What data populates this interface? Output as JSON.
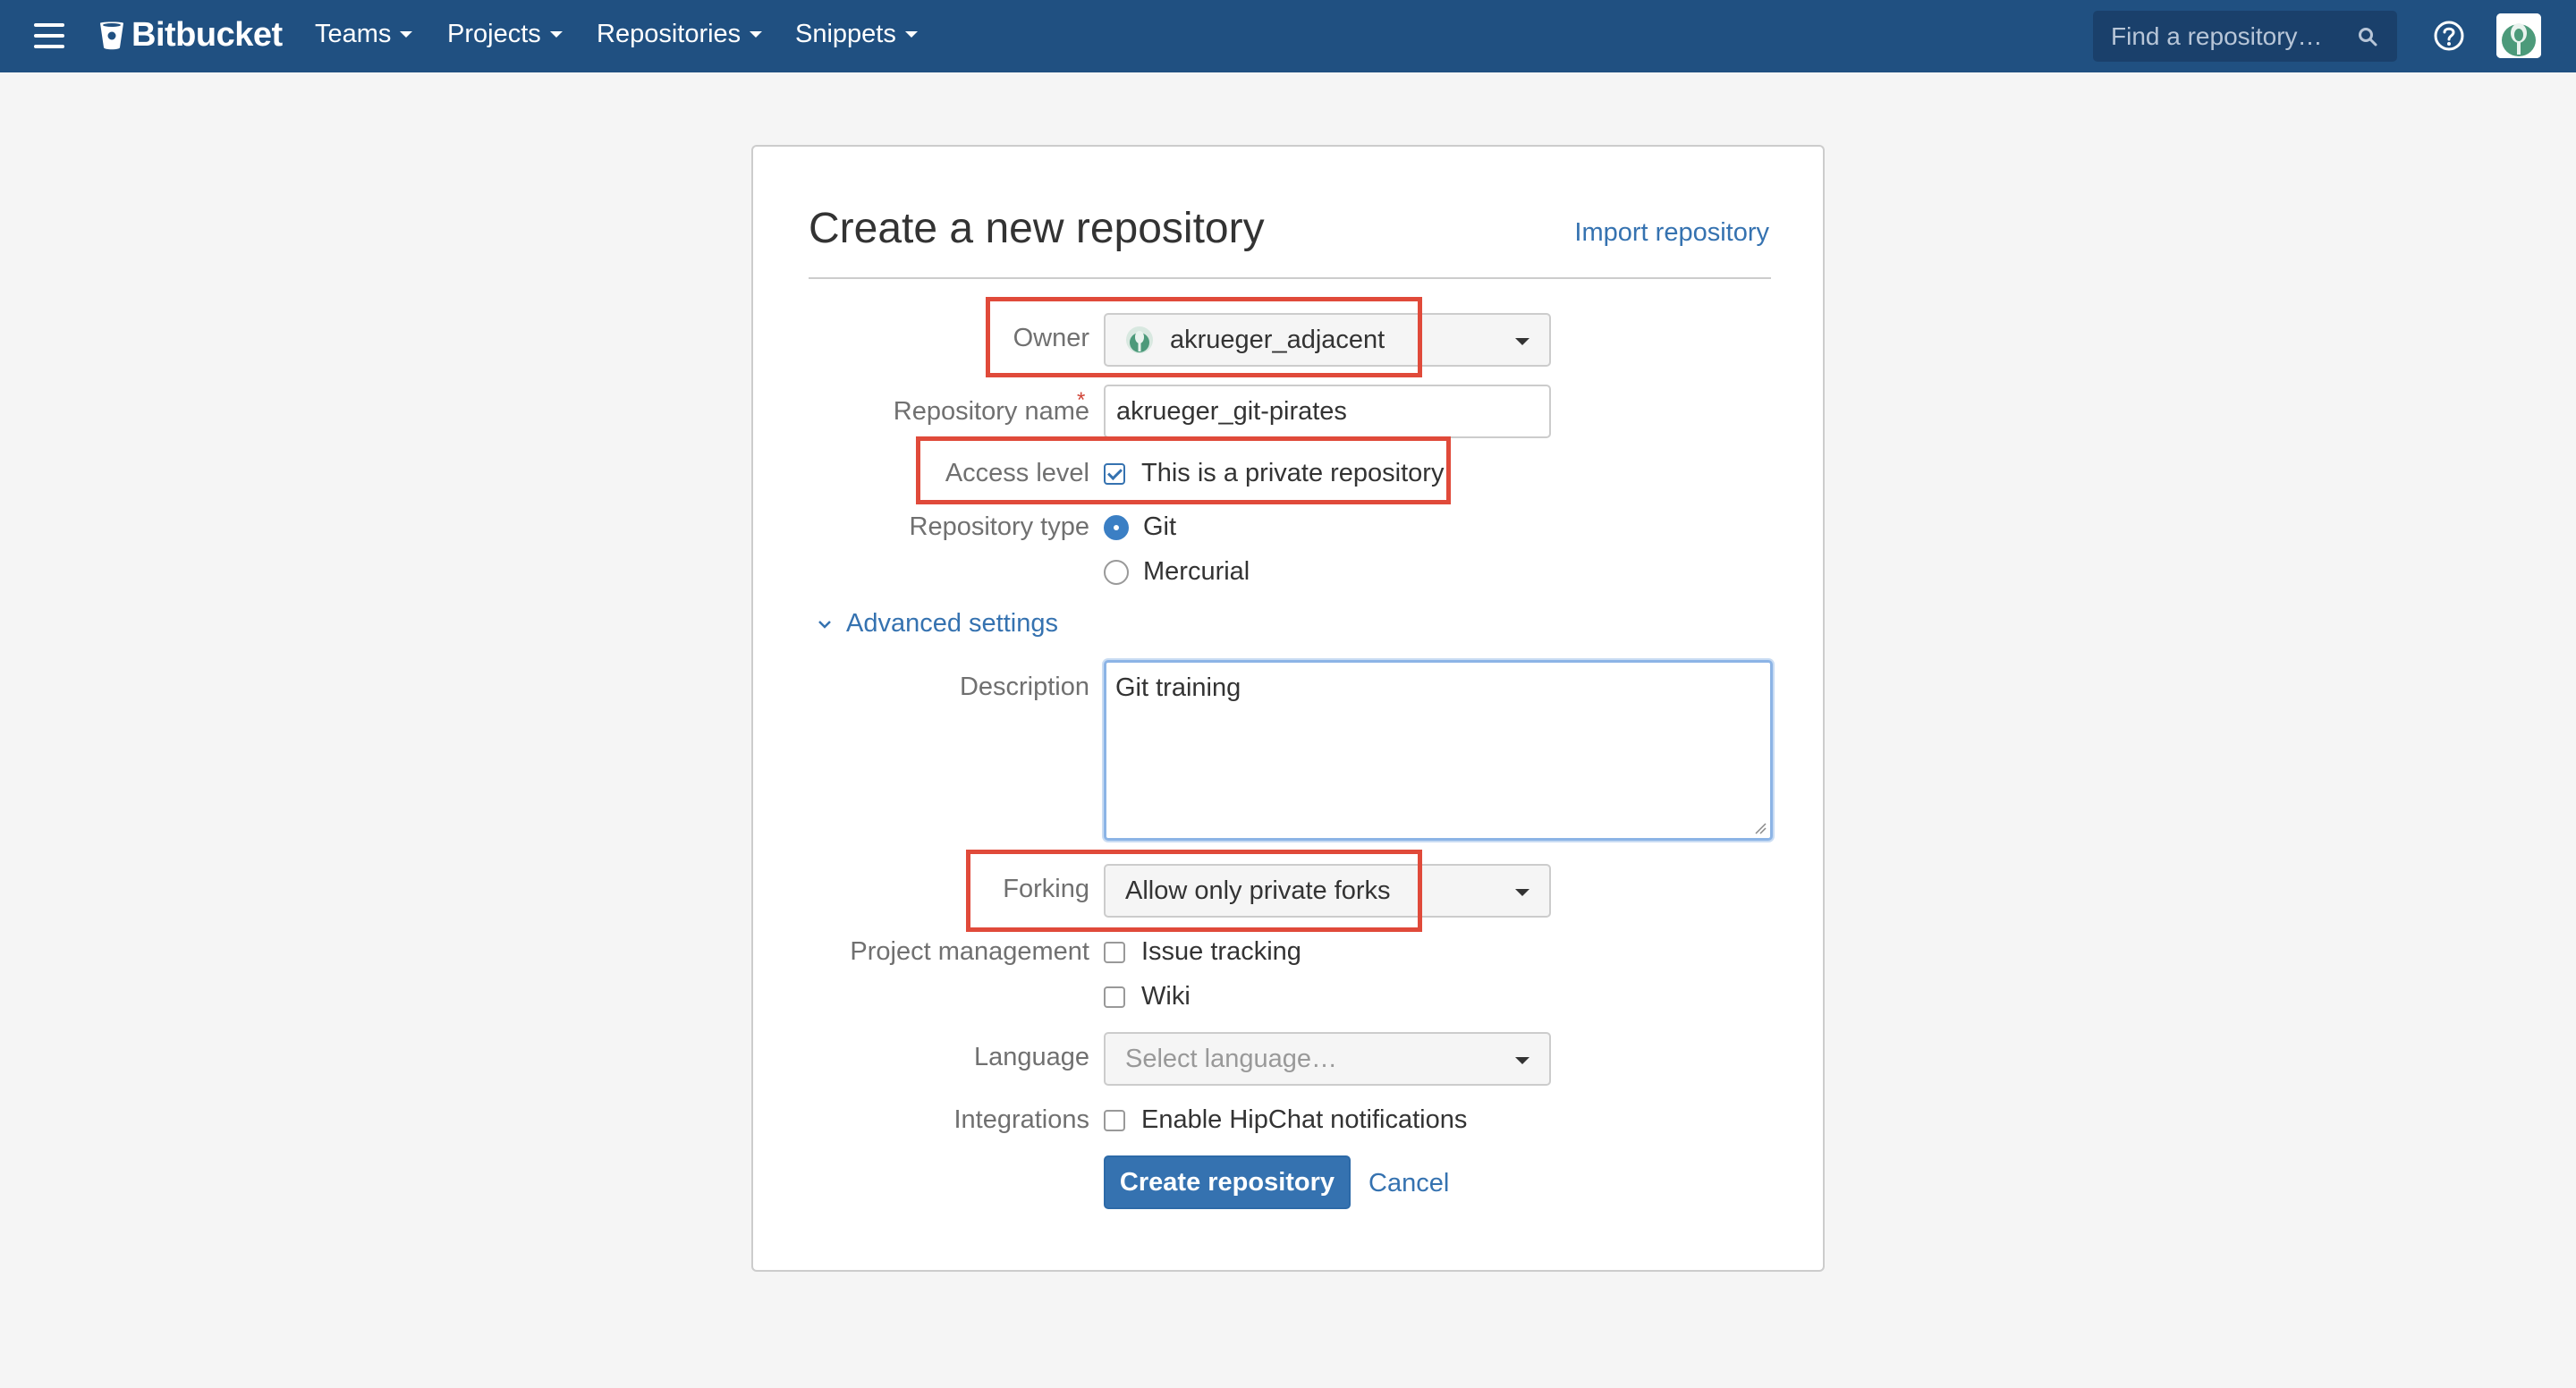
{
  "topbar": {
    "brand": "Bitbucket",
    "nav": [
      {
        "label": "Teams"
      },
      {
        "label": "Projects"
      },
      {
        "label": "Repositories"
      },
      {
        "label": "Snippets"
      }
    ],
    "search_placeholder": "Find a repository…"
  },
  "form": {
    "title": "Create a new repository",
    "import_link": "Import repository",
    "owner": {
      "label": "Owner",
      "value": "akrueger_adjacent"
    },
    "repo_name": {
      "label": "Repository name",
      "required_mark": "*",
      "value": "akrueger_git-pirates"
    },
    "access": {
      "label": "Access level",
      "checkbox_label": "This is a private repository",
      "checked": true
    },
    "repo_type": {
      "label": "Repository type",
      "options": [
        "Git",
        "Mercurial"
      ],
      "selected": "Git"
    },
    "advanced_label": "Advanced settings",
    "description": {
      "label": "Description",
      "value": "Git training"
    },
    "forking": {
      "label": "Forking",
      "value": "Allow only private forks"
    },
    "project_management": {
      "label": "Project management",
      "options": [
        "Issue tracking",
        "Wiki"
      ]
    },
    "language": {
      "label": "Language",
      "placeholder": "Select language…"
    },
    "integrations": {
      "label": "Integrations",
      "checkbox_label": "Enable HipChat notifications"
    },
    "submit_label": "Create repository",
    "cancel_label": "Cancel"
  },
  "colors": {
    "topbar_bg": "#205081",
    "link": "#3572b0",
    "primary_button": "#3572b0",
    "highlight_box": "#e04a3a",
    "required_star": "#d04437"
  },
  "icons": [
    "menu-icon",
    "bitbucket-logo-icon",
    "search-icon",
    "help-icon",
    "user-avatar-icon",
    "owner-avatar-icon",
    "chevron-down-icon",
    "dropdown-caret-icon"
  ]
}
